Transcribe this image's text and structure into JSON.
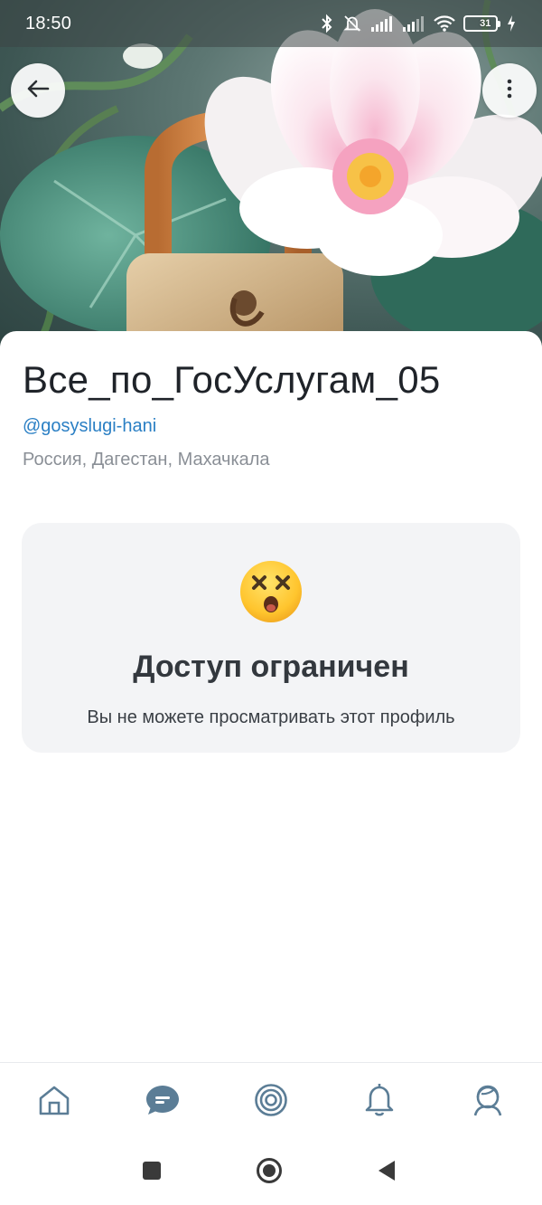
{
  "status_bar": {
    "time": "18:50",
    "battery_level": "31"
  },
  "profile": {
    "name": "Все_по_ГосУслугам_05",
    "handle": "@gosyslugi-hani",
    "location": "Россия, Дагестан, Махачкала"
  },
  "restricted": {
    "emoji": "dizzy-face",
    "title": "Доступ ограничен",
    "subtitle": "Вы не можете просматривать этот профиль"
  },
  "bottom_nav": {
    "items": [
      "home-icon",
      "messages-icon",
      "target-icon",
      "bell-icon",
      "support-icon"
    ],
    "active": "messages-icon"
  },
  "colors": {
    "accent": "#2a7fc4",
    "nav_icon": "#5b7d96",
    "card_bg": "#f3f4f6"
  }
}
